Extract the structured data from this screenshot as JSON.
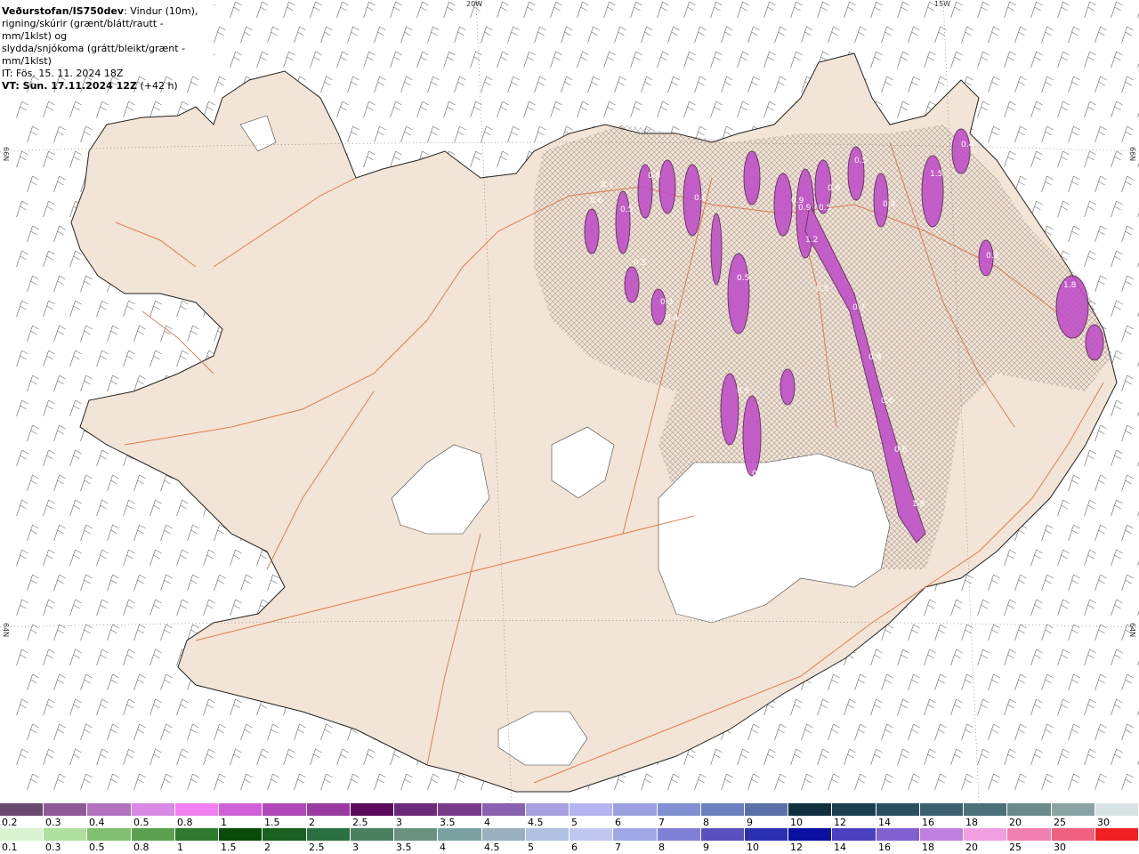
{
  "header": {
    "brand": "Veðurstofan/IS750dev",
    "desc1": ": Vindur (10m),",
    "desc2": "rigning/skúrir (grænt/blátt/rautt - mm/1klst) og",
    "desc3": "slydda/snjókoma (grátt/bleikt/grænt - mm/1klst)",
    "init": "IT: Fös. 15. 11. 2024 18Z",
    "valid": "VT: Sun. 17.11.2024 12Z",
    "lead": "(+42 h)"
  },
  "grid_labels": {
    "lon_20w": "20W",
    "lon_15w": "15W",
    "lat_66n_left": "66N",
    "lat_66n_right": "66N",
    "lat_64n_left": "64N",
    "lat_64n_right": "64N"
  },
  "precip_labels": [
    "0.6",
    "0.7",
    "0.5",
    "0.8",
    "0.6",
    "0.3",
    "0.5",
    "0.4",
    "1.2",
    "0.9",
    "0.5",
    "0.6",
    "0.4",
    "0.5",
    "1.5",
    "0.4",
    "0.5",
    "1.8",
    "0.5",
    "0.7",
    "0.6",
    "0.5",
    "0.9",
    "0.6",
    "0.6",
    "0.5",
    "0.4",
    "1.8"
  ],
  "legend": {
    "snow_ticks": [
      "0.2",
      "0.3",
      "0.4",
      "0.5",
      "0.8",
      "1",
      "1.5",
      "2",
      "2.5",
      "3",
      "3.5",
      "4",
      "4.5",
      "5",
      "6",
      "7",
      "8",
      "9",
      "10",
      "12",
      "14",
      "16",
      "18",
      "20",
      "25",
      "30"
    ],
    "snow_colors": [
      "#6b4a6f",
      "#8e5a95",
      "#b272c0",
      "#d88ae4",
      "#f080f0",
      "#d060d8",
      "#b048b8",
      "#9a3aa0",
      "#5a0a5a",
      "#6b2a7a",
      "#7a3a8c",
      "#8a60b0",
      "#a8a0e0",
      "#b4b4f0",
      "#9aa0e0",
      "#8090d0",
      "#6a80c0",
      "#5a70a8",
      "#103040",
      "#1a4050",
      "#2a5060",
      "#3a6070",
      "#4a7078",
      "#6a8a8c",
      "#8aa4a4",
      "#d8e4e4"
    ],
    "rain_ticks": [
      "0.1",
      "0.3",
      "0.5",
      "0.8",
      "1",
      "1.5",
      "2",
      "2.5",
      "3",
      "3.5",
      "4",
      "4.5",
      "5",
      "6",
      "7",
      "8",
      "9",
      "10",
      "12",
      "14",
      "16",
      "18",
      "20",
      "25",
      "30"
    ],
    "rain_colors": [
      "#d8f4d0",
      "#b0e0a0",
      "#80c070",
      "#5aa050",
      "#2e7a2e",
      "#0a4a0a",
      "#1a6020",
      "#2a7040",
      "#4a8060",
      "#6a9080",
      "#7aa0a0",
      "#9ab0c0",
      "#b0c0e0",
      "#c0c8f0",
      "#a0a8e8",
      "#8080d8",
      "#5a50c0",
      "#2a30b0",
      "#0a10a0",
      "#4a40c0",
      "#8060d0",
      "#c080e0",
      "#f0a0e0",
      "#f080b0",
      "#f06080",
      "#f02020"
    ]
  }
}
